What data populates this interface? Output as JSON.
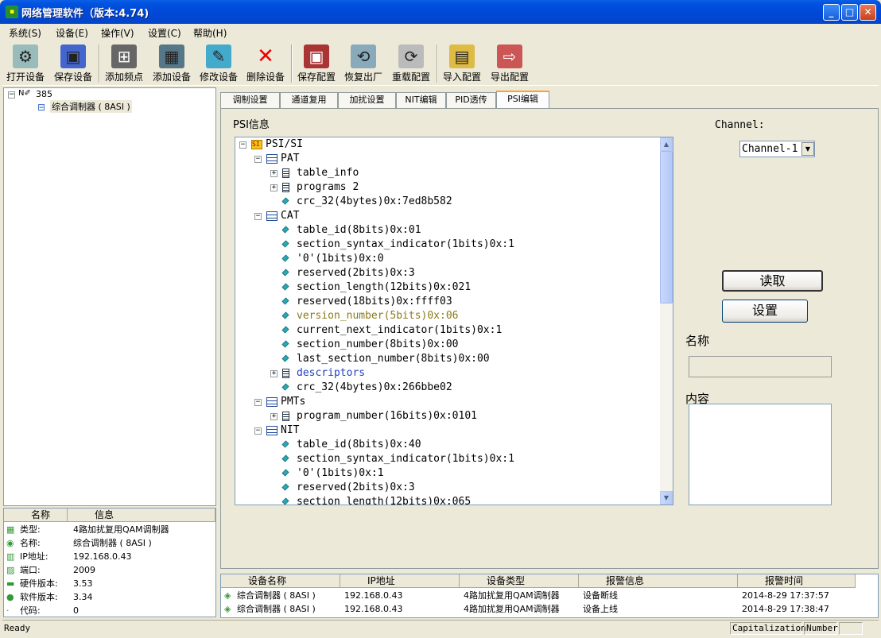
{
  "window": {
    "title": "网络管理软件（版本:4.74)"
  },
  "menu": [
    "系统(S)",
    "设备(E)",
    "操作(V)",
    "设置(C)",
    "帮助(H)"
  ],
  "toolbar": [
    "打开设备",
    "保存设备",
    "添加频点",
    "添加设备",
    "修改设备",
    "删除设备",
    "保存配置",
    "恢复出厂",
    "重载配置",
    "导入配置",
    "导出配置"
  ],
  "device_tree": {
    "root": "385",
    "child": "综合调制器 ( 8ASI )"
  },
  "info": {
    "headers": [
      "名称",
      "信息"
    ],
    "rows": [
      {
        "k": "类型:",
        "v": "4路加扰复用QAM调制器"
      },
      {
        "k": "名称:",
        "v": "综合调制器 ( 8ASI )"
      },
      {
        "k": "IP地址:",
        "v": "192.168.0.43"
      },
      {
        "k": "端口:",
        "v": "2009"
      },
      {
        "k": "硬件版本:",
        "v": "3.53"
      },
      {
        "k": "软件版本:",
        "v": "3.34"
      },
      {
        "k": "代码:",
        "v": "0"
      }
    ]
  },
  "tabs": [
    "调制设置",
    "通道复用",
    "加扰设置",
    "NIT编辑",
    "PID透传",
    "PSI编辑"
  ],
  "psi": {
    "label": "PSI信息",
    "nodes": [
      {
        "t": "PSI/SI",
        "lv": 0,
        "k": "root"
      },
      {
        "t": "PAT",
        "lv": 1,
        "k": "tbl"
      },
      {
        "t": "table_info",
        "lv": 2,
        "k": "lst"
      },
      {
        "t": "programs 2",
        "lv": 2,
        "k": "lst"
      },
      {
        "t": "crc_32(4bytes)0x:7ed8b582",
        "lv": 2,
        "k": "leaf"
      },
      {
        "t": "CAT",
        "lv": 1,
        "k": "tbl"
      },
      {
        "t": "table_id(8bits)0x:01",
        "lv": 2,
        "k": "leaf"
      },
      {
        "t": "section_syntax_indicator(1bits)0x:1",
        "lv": 2,
        "k": "leaf"
      },
      {
        "t": "'0'(1bits)0x:0",
        "lv": 2,
        "k": "leaf"
      },
      {
        "t": "reserved(2bits)0x:3",
        "lv": 2,
        "k": "leaf"
      },
      {
        "t": "section_length(12bits)0x:021",
        "lv": 2,
        "k": "leaf"
      },
      {
        "t": "reserved(18bits)0x:ffff03",
        "lv": 2,
        "k": "leaf"
      },
      {
        "t": "version_number(5bits)0x:06",
        "lv": 2,
        "k": "leaf",
        "c": "#8B7A1A"
      },
      {
        "t": "current_next_indicator(1bits)0x:1",
        "lv": 2,
        "k": "leaf"
      },
      {
        "t": "section_number(8bits)0x:00",
        "lv": 2,
        "k": "leaf"
      },
      {
        "t": "last_section_number(8bits)0x:00",
        "lv": 2,
        "k": "leaf"
      },
      {
        "t": "descriptors",
        "lv": 2,
        "k": "lst",
        "c": "#1F3FBF"
      },
      {
        "t": "crc_32(4bytes)0x:266bbe02",
        "lv": 2,
        "k": "leaf"
      },
      {
        "t": "PMTs",
        "lv": 1,
        "k": "tbl"
      },
      {
        "t": "program_number(16bits)0x:0101",
        "lv": 2,
        "k": "lst"
      },
      {
        "t": "NIT",
        "lv": 1,
        "k": "tbl"
      },
      {
        "t": "table_id(8bits)0x:40",
        "lv": 2,
        "k": "leaf"
      },
      {
        "t": "section_syntax_indicator(1bits)0x:1",
        "lv": 2,
        "k": "leaf"
      },
      {
        "t": "'0'(1bits)0x:1",
        "lv": 2,
        "k": "leaf"
      },
      {
        "t": "reserved(2bits)0x:3",
        "lv": 2,
        "k": "leaf"
      },
      {
        "t": "section_length(12bits)0x:065",
        "lv": 2,
        "k": "leaf"
      }
    ]
  },
  "channel": {
    "label": "Channel:",
    "value": "Channel-1"
  },
  "buttons": {
    "read": "读取",
    "set": "设置"
  },
  "fields": {
    "name_label": "名称",
    "content_label": "内容"
  },
  "alarms": {
    "headers": [
      "设备名称",
      "IP地址",
      "设备类型",
      "报警信息",
      "报警时间"
    ],
    "rows": [
      [
        "综合调制器 ( 8ASI )",
        "192.168.0.43",
        "4路加扰复用QAM调制器",
        "设备断线",
        "2014-8-29 17:37:57"
      ],
      [
        "综合调制器 ( 8ASI )",
        "192.168.0.43",
        "4路加扰复用QAM调制器",
        "设备上线",
        "2014-8-29 17:38:47"
      ]
    ]
  },
  "status": {
    "left": "Ready",
    "caps": "Capitalization",
    "num": "Number"
  }
}
